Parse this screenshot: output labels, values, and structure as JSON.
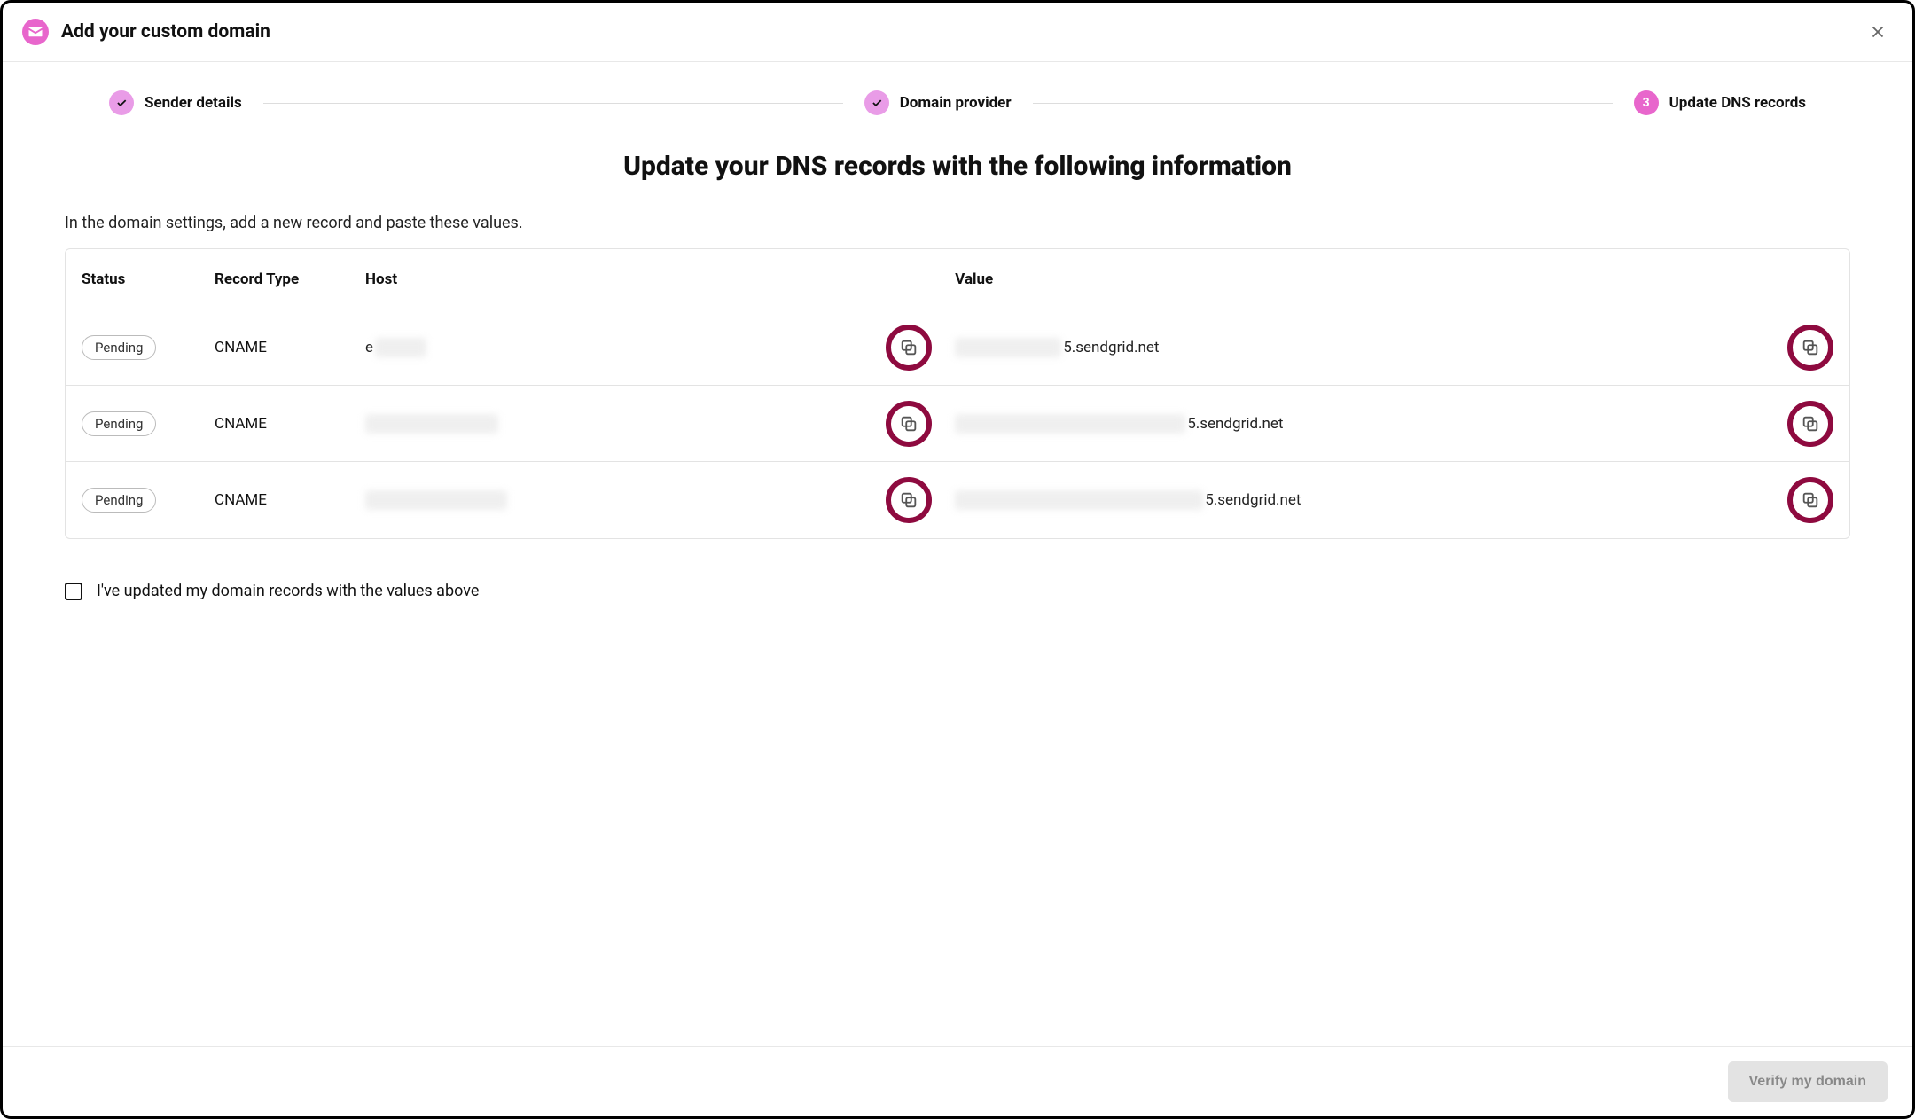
{
  "header": {
    "title": "Add your custom domain"
  },
  "stepper": {
    "steps": [
      {
        "label": "Sender details",
        "state": "done"
      },
      {
        "label": "Domain provider",
        "state": "done"
      },
      {
        "label": "Update DNS records",
        "state": "current",
        "number": "3"
      }
    ]
  },
  "heading": "Update your DNS records with the following information",
  "instruction": "In the domain settings, add a new record and paste these values.",
  "table": {
    "columns": {
      "status": "Status",
      "type": "Record Type",
      "host": "Host",
      "value": "Value"
    },
    "rows": [
      {
        "status": "Pending",
        "type": "CNAME",
        "host_prefix": "e",
        "value_suffix": "5.sendgrid.net"
      },
      {
        "status": "Pending",
        "type": "CNAME",
        "host_prefix": "",
        "value_suffix": "5.sendgrid.net"
      },
      {
        "status": "Pending",
        "type": "CNAME",
        "host_prefix": "",
        "value_suffix": "5.sendgrid.net"
      }
    ]
  },
  "checkbox_label": "I've updated my domain records with the values above",
  "verify_button": "Verify my domain",
  "accent_color": "#e866cc",
  "ring_color": "#8e0a3f"
}
